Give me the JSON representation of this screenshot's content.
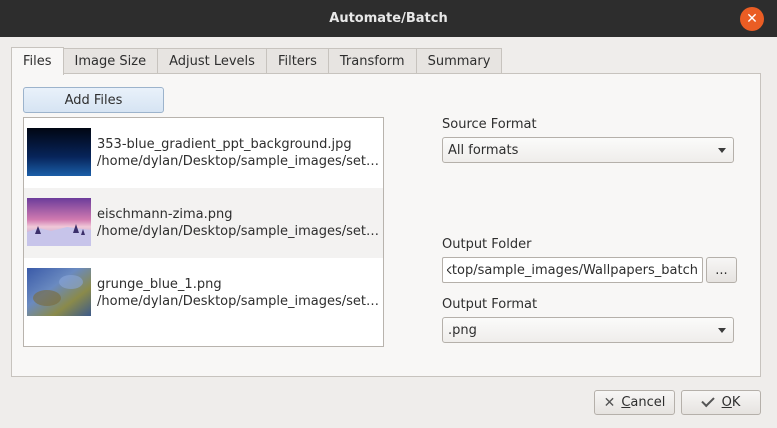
{
  "window": {
    "title": "Automate/Batch",
    "close_icon": "close-icon",
    "close_glyph": "✕"
  },
  "tabs": [
    {
      "label": "Files",
      "active": true
    },
    {
      "label": "Image Size",
      "active": false
    },
    {
      "label": "Adjust Levels",
      "active": false
    },
    {
      "label": "Filters",
      "active": false
    },
    {
      "label": "Transform",
      "active": false
    },
    {
      "label": "Summary",
      "active": false
    }
  ],
  "files_panel": {
    "add_files_label": "Add Files",
    "files": [
      {
        "name": "353-blue_gradient_ppt_background.jpg",
        "path": "/home/dylan/Desktop/sample_images/set…",
        "thumb": "dark-blue-gradient"
      },
      {
        "name": "eischmann-zima.png",
        "path": "/home/dylan/Desktop/sample_images/set…",
        "thumb": "winter-sunset"
      },
      {
        "name": "grunge_blue_1.png",
        "path": "/home/dylan/Desktop/sample_images/set…",
        "thumb": "grunge-blue"
      }
    ],
    "source_format": {
      "label": "Source Format",
      "value": "All formats"
    },
    "output_folder": {
      "label": "Output Folder",
      "value": "ktop/sample_images/Wallpapers_batch",
      "browse_label": "..."
    },
    "output_format": {
      "label": "Output Format",
      "value": ".png"
    }
  },
  "footer": {
    "cancel_first_letter": "C",
    "cancel_rest": "ancel",
    "ok_first_letter": "O",
    "ok_rest": "K"
  },
  "colors": {
    "titlebar": "#2d2d2d",
    "close_button": "#ea5d24",
    "panel": "#f8f7f6",
    "window_bg": "#efedeb"
  }
}
